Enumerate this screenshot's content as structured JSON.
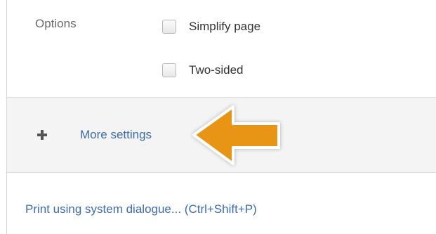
{
  "options": {
    "label": "Options",
    "items": [
      {
        "label": "Simplify page",
        "checked": false
      },
      {
        "label": "Two-sided",
        "checked": false
      }
    ]
  },
  "more_settings": {
    "icon": "plus-icon",
    "label": "More settings"
  },
  "annotation": {
    "icon": "arrow-left-icon",
    "color": "#e89512"
  },
  "system_dialog": {
    "label": "Print using system dialogue... (Ctrl+Shift+P)"
  },
  "colors": {
    "link": "#3c6bb3",
    "section_bg": "#f4f4f4"
  }
}
